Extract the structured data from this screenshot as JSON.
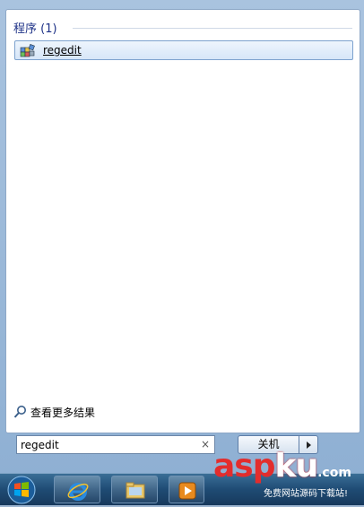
{
  "results": {
    "group_title": "程序 (1)",
    "items": [
      {
        "label": "regedit",
        "icon": "registry-editor-icon"
      }
    ]
  },
  "see_more": {
    "label": "查看更多结果",
    "icon": "search-icon"
  },
  "search": {
    "value": "regedit",
    "clear_glyph": "×"
  },
  "shutdown": {
    "label": "关机"
  },
  "taskbar": {
    "pinned": [
      {
        "name": "internet-explorer",
        "icon": "ie-icon"
      },
      {
        "name": "windows-explorer",
        "icon": "folder-icon"
      },
      {
        "name": "media-player",
        "icon": "media-player-icon"
      }
    ]
  },
  "watermark": {
    "brand_a": "asp",
    "brand_b": "ku",
    "brand_c": ".com",
    "tagline": "免费网站源码下载站!"
  },
  "colors": {
    "accent": "#1e3287",
    "selection": "#d6e6f8",
    "watermark_red": "#e32d2d"
  }
}
